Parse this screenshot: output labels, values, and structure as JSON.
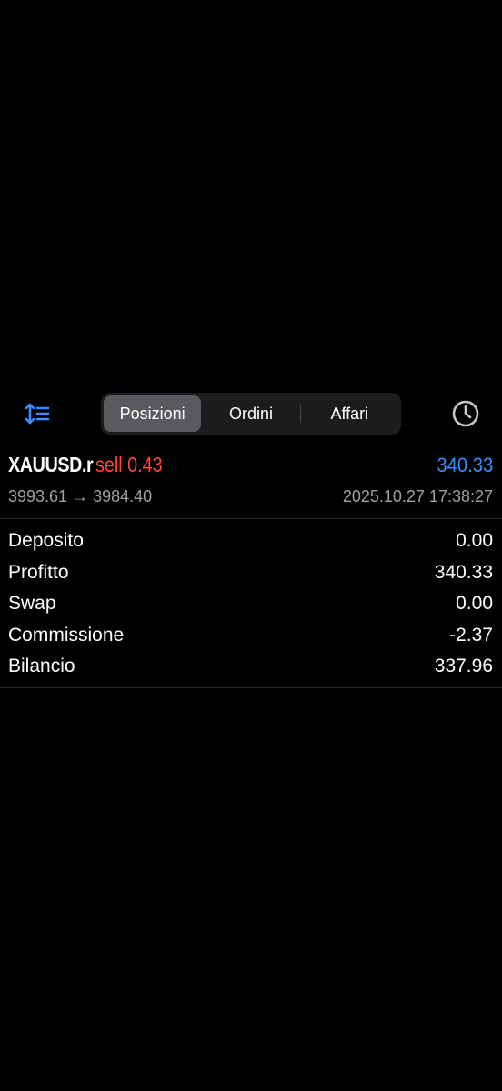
{
  "toolbar": {
    "sort_icon": "sort-list-icon",
    "history_icon": "clock-icon",
    "tabs": [
      {
        "label": "Posizioni",
        "active": true
      },
      {
        "label": "Ordini",
        "active": false
      },
      {
        "label": "Affari",
        "active": false
      }
    ]
  },
  "position": {
    "symbol": "XAUUSD.r",
    "side_volume": "sell 0.43",
    "profit": "340.33",
    "prices": "3993.61 → 3984.40",
    "time": "2025.10.27 17:38:27"
  },
  "details": [
    {
      "label": "Deposito",
      "value": "0.00"
    },
    {
      "label": "Profitto",
      "value": "340.33"
    },
    {
      "label": "Swap",
      "value": "0.00"
    },
    {
      "label": "Commissione",
      "value": "-2.37"
    },
    {
      "label": "Bilancio",
      "value": "337.96"
    }
  ],
  "colors": {
    "accent": "#3b8cff",
    "sell": "#ff453a",
    "secondary_text": "#a0a0a5"
  }
}
